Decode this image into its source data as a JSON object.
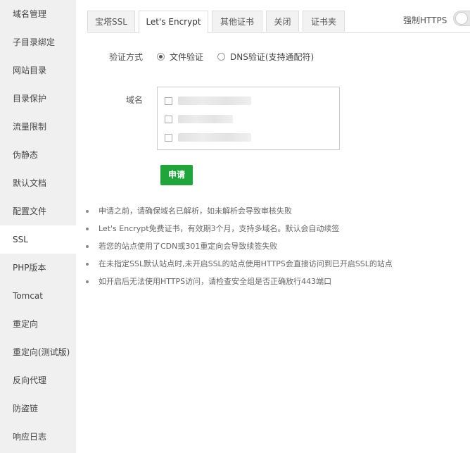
{
  "sidebar": {
    "items": [
      {
        "label": "域名管理"
      },
      {
        "label": "子目录绑定"
      },
      {
        "label": "网站目录"
      },
      {
        "label": "目录保护"
      },
      {
        "label": "流量限制"
      },
      {
        "label": "伪静态"
      },
      {
        "label": "默认文档"
      },
      {
        "label": "配置文件"
      },
      {
        "label": "SSL",
        "active": true
      },
      {
        "label": "PHP版本"
      },
      {
        "label": "Tomcat"
      },
      {
        "label": "重定向"
      },
      {
        "label": "重定向(测试版)"
      },
      {
        "label": "反向代理"
      },
      {
        "label": "防盗链"
      },
      {
        "label": "响应日志"
      }
    ]
  },
  "tabs": [
    {
      "label": "宝塔SSL"
    },
    {
      "label": "Let's Encrypt",
      "active": true
    },
    {
      "label": "其他证书"
    },
    {
      "label": "关闭"
    },
    {
      "label": "证书夹"
    }
  ],
  "force_https": {
    "label": "强制HTTPS",
    "enabled": false
  },
  "verify": {
    "label": "验证方式",
    "options": [
      {
        "label": "文件验证",
        "checked": true
      },
      {
        "label": "DNS验证(支持通配符)",
        "checked": false
      }
    ]
  },
  "domain": {
    "label": "域名",
    "count": 3
  },
  "apply_button": {
    "label": "申请"
  },
  "tips": [
    "申请之前，请确保域名已解析，如未解析会导致审核失败",
    "Let's Encrypt免费证书，有效期3个月，支持多域名。默认会自动续签",
    "若您的站点使用了CDN或301重定向会导致续签失败",
    "在未指定SSL默认站点时,未开启SSL的站点使用HTTPS会直接访问到已开启SSL的站点",
    "如开启后无法使用HTTPS访问，请检查安全组是否正确放行443端口"
  ],
  "colors": {
    "accent": "#20a53a",
    "sidebar_bg": "#f0f0f0",
    "tab_bg": "#f2f2f2"
  }
}
